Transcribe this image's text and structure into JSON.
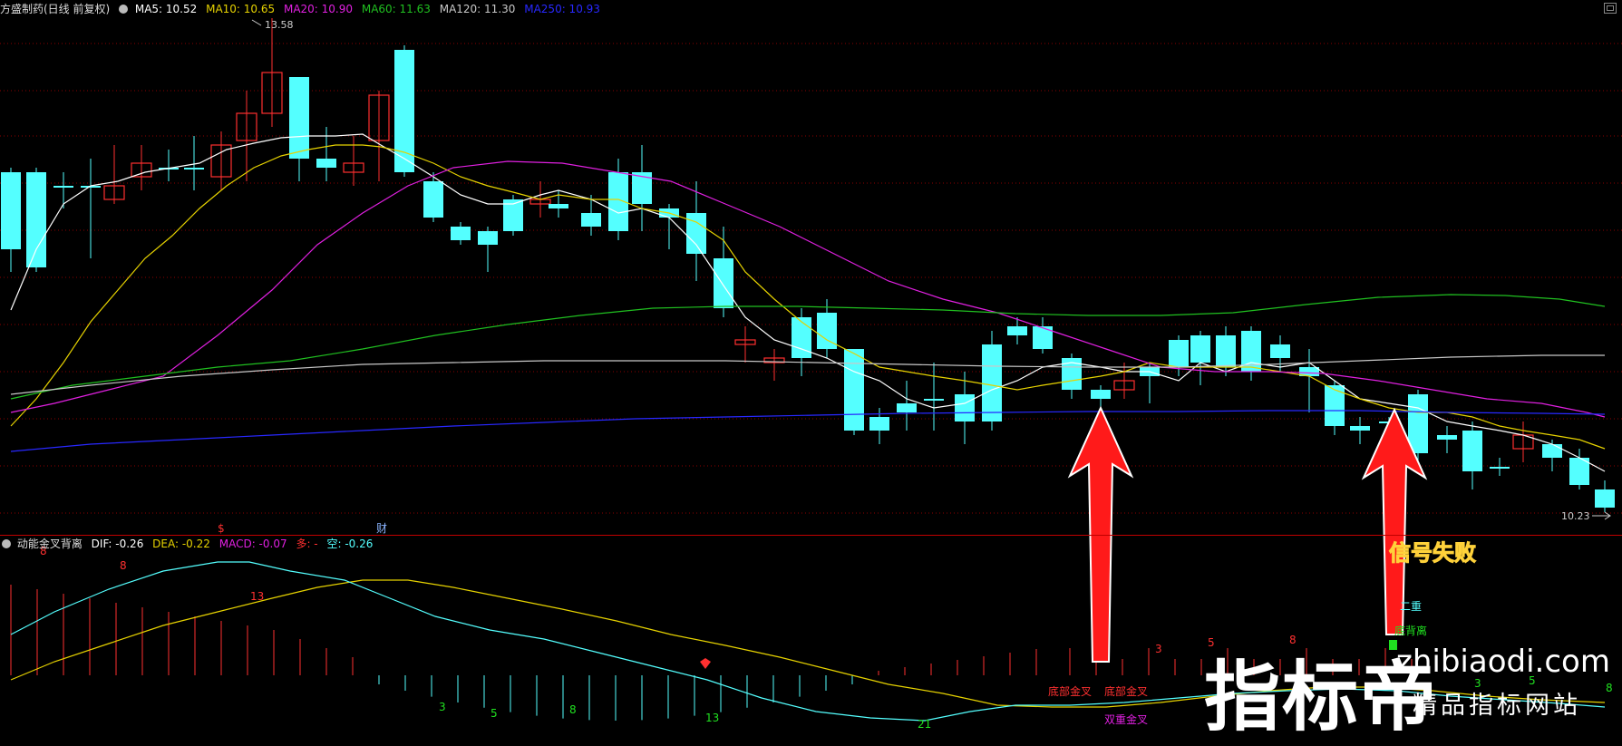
{
  "header": {
    "stock_name": "方盛制药(日线 前复权)",
    "ma5": "MA5: 10.52",
    "ma10": "MA10: 10.65",
    "ma20": "MA20: 10.90",
    "ma60": "MA60: 11.63",
    "ma120": "MA120: 11.30",
    "ma250": "MA250: 10.93"
  },
  "colors": {
    "ma5": "#ffffff",
    "ma10": "#e6d200",
    "ma20": "#e020e0",
    "ma60": "#20c020",
    "ma120": "#c8c8c8",
    "ma250": "#2828ff",
    "up": "#ff3030",
    "down": "#54ffff",
    "grid": "#8b0000"
  },
  "price_chart": {
    "high_label": "13.58",
    "low_label": "10.23",
    "bottom_markers": [
      "$",
      "财"
    ]
  },
  "indicator": {
    "name": "动能金叉背离",
    "dif": "DIF: -0.26",
    "dea": "DEA: -0.22",
    "macd": "MACD: -0.07",
    "duo": "多: -",
    "kong": "空: -0.26"
  },
  "annotations": {
    "bottom_cross_1": "底部金叉",
    "bottom_cross_2": "底部金叉",
    "double_cross": "双重金叉",
    "fail_label": "信号失败",
    "double": "二重",
    "bottom_divergence": "底背离",
    "count_labels": [
      {
        "text": "8",
        "color": "#ff3030"
      },
      {
        "text": "8",
        "color": "#ff3030"
      },
      {
        "text": "13",
        "color": "#ff3030"
      },
      {
        "text": "3",
        "color": "#20e020"
      },
      {
        "text": "5",
        "color": "#20e020"
      },
      {
        "text": "8",
        "color": "#20e020"
      },
      {
        "text": "13",
        "color": "#20e020"
      },
      {
        "text": "21",
        "color": "#20e020"
      },
      {
        "text": "3",
        "color": "#ff3030"
      },
      {
        "text": "5",
        "color": "#ff3030"
      },
      {
        "text": "8",
        "color": "#ff3030"
      },
      {
        "text": "3",
        "color": "#20e020"
      },
      {
        "text": "5",
        "color": "#20e020"
      },
      {
        "text": "8",
        "color": "#20e020"
      }
    ]
  },
  "watermark": {
    "brand": "指标帝",
    "url": "zhibiaodi.com",
    "tagline": "精品指标网站"
  },
  "icons": {
    "arrow": "red-up-arrow",
    "settings": "circle-dropdown-icon",
    "window": "maximize-icon"
  }
}
